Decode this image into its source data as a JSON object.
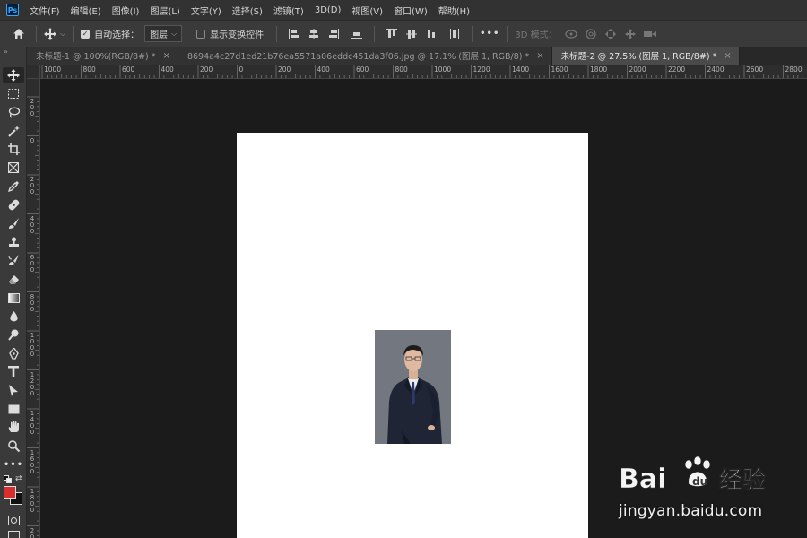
{
  "app": {
    "logo_text": "Ps",
    "accent_color": "#31a8ff"
  },
  "menubar": {
    "items": [
      "文件(F)",
      "编辑(E)",
      "图像(I)",
      "图层(L)",
      "文字(Y)",
      "选择(S)",
      "滤镜(T)",
      "3D(D)",
      "视图(V)",
      "窗口(W)",
      "帮助(H)"
    ]
  },
  "options": {
    "auto_select_label": "自动选择：",
    "auto_select_checked": true,
    "auto_select_target": "图层",
    "show_transform_label": "显示变换控件",
    "show_transform_checked": false,
    "mode_3d_label": "3D 模式：",
    "more_label": "•••"
  },
  "tabs": [
    {
      "title": "未标题-1 @ 100%(RGB/8#) *",
      "active": false
    },
    {
      "title": "8694a4c27d1ed21b76ea5571a06eddc451da3f06.jpg @ 17.1% (图层 1, RGB/8) *",
      "active": false
    },
    {
      "title": "未标题-2 @ 27.5% (图层 1, RGB/8#) *",
      "active": true
    }
  ],
  "tab_close_glyph": "×",
  "rulers": {
    "top_labels": [
      "1000",
      "800",
      "600",
      "400",
      "200",
      "0",
      "200",
      "400",
      "600",
      "800",
      "1000",
      "1200",
      "1400",
      "1600",
      "1800",
      "2000",
      "2200",
      "2400",
      "2600",
      "2800"
    ],
    "left_labels": [
      "200",
      "0",
      "200",
      "400",
      "600",
      "800",
      "1000",
      "1200",
      "1400",
      "1600",
      "1800",
      "2000"
    ]
  },
  "colors": {
    "foreground": "#d82e2e",
    "background": "#111111",
    "canvas": "#ffffff",
    "workspace": "#1b1b1b"
  },
  "watermark": {
    "brand_text": "Bai",
    "brand_text_2": "经验",
    "url": "jingyan.baidu.com"
  }
}
